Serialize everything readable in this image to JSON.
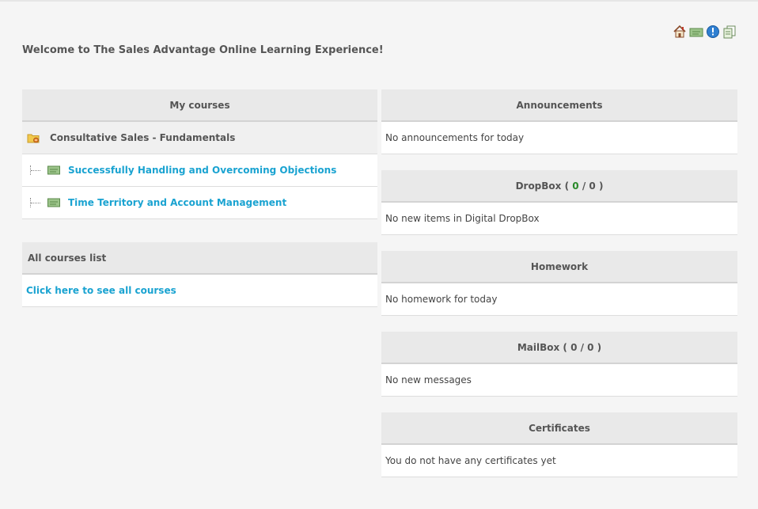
{
  "header": {
    "welcome": "Welcome to The Sales Advantage Online Learning Experience!",
    "toolbar_icons": [
      "home-icon",
      "course-icon",
      "info-icon",
      "document-icon"
    ]
  },
  "my_courses": {
    "title": "My courses",
    "category": "Consultative Sales - Fundamentals",
    "courses": [
      "Successfully Handling and Overcoming Objections",
      "Time Territory and Account Management"
    ]
  },
  "all_courses": {
    "title": "All courses list",
    "link": "Click here to see all courses"
  },
  "announcements": {
    "title": "Announcements",
    "message": "No announcements for today"
  },
  "dropbox": {
    "title": "DropBox",
    "open": "(",
    "new_count": "0",
    "sep": "/",
    "total_count": "0",
    "close": ")",
    "message": "No new items in Digital DropBox"
  },
  "homework": {
    "title": "Homework",
    "message": "No homework for today"
  },
  "mailbox": {
    "title": "MailBox ( 0 / 0 )",
    "message": "No new messages"
  },
  "certificates": {
    "title": "Certificates",
    "message": "You do not have any certificates yet"
  },
  "colors": {
    "link": "#1aa3d1",
    "count_new": "#2a8a2a",
    "header_bg": "#e9e9e9"
  }
}
